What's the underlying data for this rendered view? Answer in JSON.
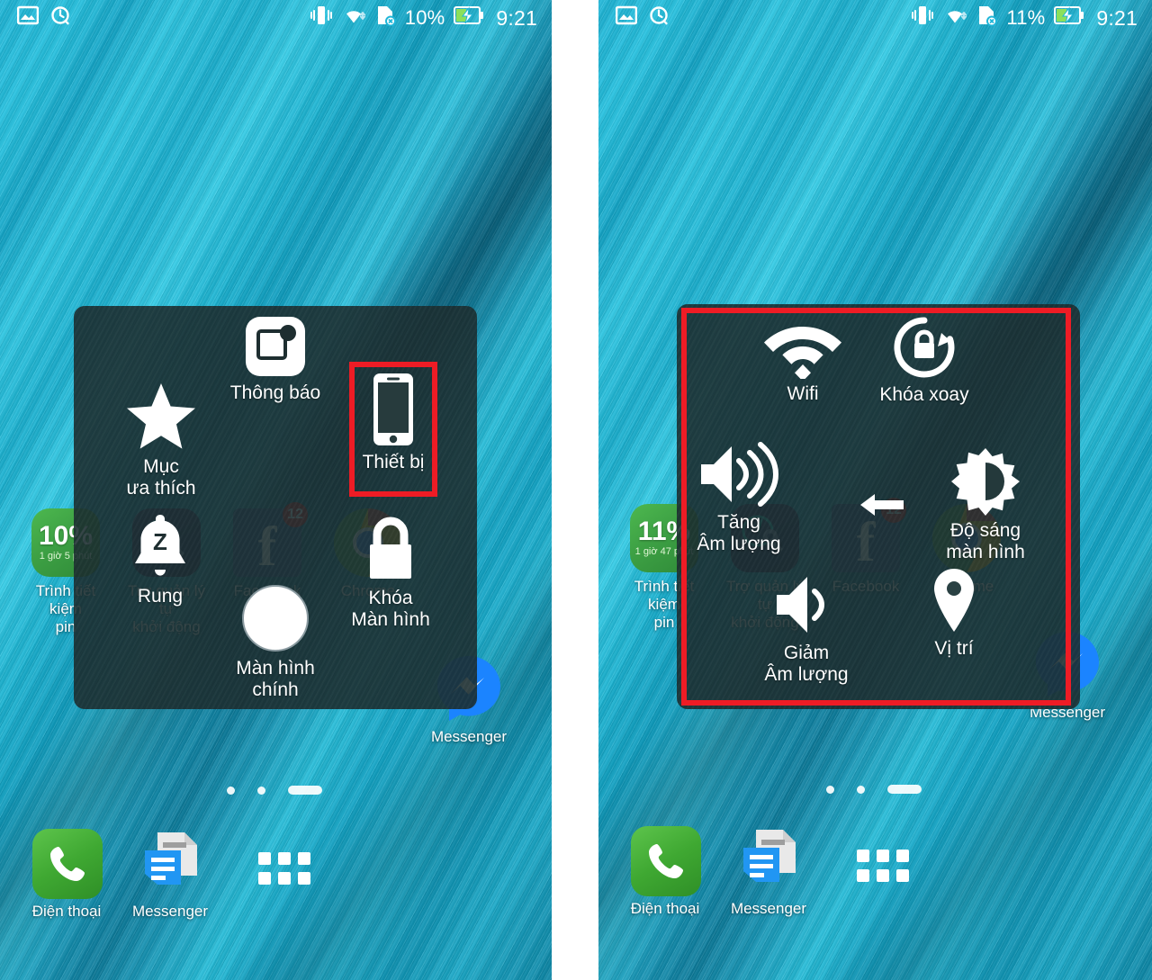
{
  "panels": [
    {
      "id": "left",
      "statusbar": {
        "gallery_icon": "image-icon",
        "tool_icon": "clock-wrench-icon",
        "vibrate_icon": "vibrate-icon",
        "wifi_icon": "wifi-icon",
        "sim_icon": "no-sim-card-icon",
        "battery_percent": "10%",
        "battery_icon": "battery-charging-icon",
        "time": "9:21"
      },
      "overlay": {
        "name": "assistive-touch-menu",
        "items": [
          {
            "name": "notification",
            "icon": "notification-square-icon",
            "label": "Thông báo"
          },
          {
            "name": "favorites",
            "icon": "star-icon",
            "label": "Mục\nưa thích"
          },
          {
            "name": "device",
            "icon": "smartphone-icon",
            "label": "Thiết bị",
            "highlighted": true
          },
          {
            "name": "vibrate",
            "icon": "bell-z-icon",
            "label": "Rung"
          },
          {
            "name": "lock-screen",
            "icon": "padlock-icon",
            "label": "Khóa\nMàn hình"
          },
          {
            "name": "home",
            "icon": "home-circle-icon",
            "label": "Màn hình\nchính"
          }
        ]
      },
      "apps": [
        {
          "name": "battery-saver",
          "icon": "battery-saver-widget",
          "label": "Trình tiết kiệm\npin",
          "value": "10%",
          "sub": "1 giờ 5 phút"
        },
        {
          "name": "mobile-manager",
          "icon": "mobile-manager-icon",
          "label": "Trợ quản lý tự\nkhởi động"
        },
        {
          "name": "facebook",
          "icon": "facebook-icon",
          "label": "Facebook",
          "badge": "12"
        },
        {
          "name": "chrome",
          "icon": "chrome-icon",
          "label": "Chrome"
        },
        {
          "name": "messenger",
          "icon": "messenger-icon",
          "label": "Messenger"
        }
      ],
      "dock": [
        {
          "name": "phone",
          "icon": "phone-icon",
          "label": "Điện thoại"
        },
        {
          "name": "messenger-sms",
          "icon": "sms-icon",
          "label": "Messenger"
        },
        {
          "name": "app-drawer",
          "icon": "app-drawer-icon",
          "label": ""
        }
      ],
      "page_indicator": {
        "dots": 2,
        "active_bar": true
      }
    },
    {
      "id": "right",
      "statusbar": {
        "gallery_icon": "image-icon",
        "tool_icon": "clock-wrench-icon",
        "vibrate_icon": "vibrate-icon",
        "wifi_icon": "wifi-icon",
        "sim_icon": "no-sim-card-icon",
        "battery_percent": "11%",
        "battery_icon": "battery-charging-icon",
        "time": "9:21"
      },
      "overlay": {
        "name": "assistive-touch-device-menu",
        "highlighted": true,
        "items": [
          {
            "name": "wifi",
            "icon": "wifi-icon",
            "label": "Wifi"
          },
          {
            "name": "rotate-lock",
            "icon": "rotation-lock-icon",
            "label": "Khóa xoay"
          },
          {
            "name": "volume-up",
            "icon": "volume-up-icon",
            "label": "Tăng\nÂm lượng"
          },
          {
            "name": "brightness",
            "icon": "brightness-icon",
            "label": "Độ sáng\nmàn hình"
          },
          {
            "name": "volume-down",
            "icon": "volume-down-icon",
            "label": "Giảm\nÂm lượng"
          },
          {
            "name": "location",
            "icon": "location-pin-icon",
            "label": "Vị trí"
          },
          {
            "name": "back",
            "icon": "arrow-left-icon",
            "label": ""
          }
        ]
      },
      "apps": [
        {
          "name": "battery-saver",
          "icon": "battery-saver-widget",
          "label": "Trình tiết kiệm\npin",
          "value": "11%",
          "sub": "1 giờ 47 phút"
        },
        {
          "name": "mobile-manager",
          "icon": "mobile-manager-icon",
          "label": "Trợ quản lý tự\nkhởi động"
        },
        {
          "name": "facebook",
          "icon": "facebook-icon",
          "label": "Facebook",
          "badge": "12"
        },
        {
          "name": "chrome",
          "icon": "chrome-icon",
          "label": "Chrome"
        },
        {
          "name": "messenger",
          "icon": "messenger-icon",
          "label": "Messenger"
        }
      ],
      "dock": [
        {
          "name": "phone",
          "icon": "phone-icon",
          "label": "Điện thoại"
        },
        {
          "name": "messenger-sms",
          "icon": "sms-icon",
          "label": "Messenger"
        },
        {
          "name": "app-drawer",
          "icon": "app-drawer-icon",
          "label": ""
        }
      ],
      "page_indicator": {
        "dots": 2,
        "active_bar": true
      }
    }
  ],
  "colors": {
    "highlight_red": "#ee1c25",
    "overlay_bg": "rgba(28,46,48,0.90)",
    "wallpaper_teal": "#1fb6d8",
    "white": "#ffffff"
  }
}
